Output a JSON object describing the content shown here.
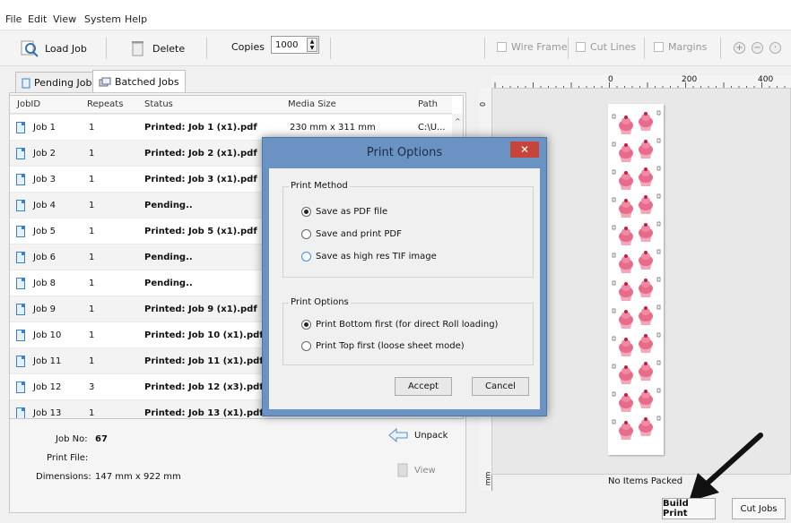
{
  "menu": [
    "File",
    "Edit",
    "View",
    "System",
    "Help"
  ],
  "toolbar": {
    "load_job": "Load Job",
    "delete": "Delete",
    "copies_label": "Copies",
    "copies_value": "1000",
    "wire_frame": "Wire Frame",
    "cut_lines": "Cut Lines",
    "margins": "Margins"
  },
  "tabs": {
    "pending": "Pending Jobs",
    "batched": "Batched Jobs"
  },
  "grid": {
    "headers": [
      "JobID",
      "Repeats",
      "Status",
      "Media Size",
      "Path"
    ],
    "rows": [
      {
        "id": "Job 1",
        "repeats": "1",
        "status": "Printed: Job 1 (x1).pdf",
        "media": "230 mm x 311 mm",
        "path": "C:\\U..."
      },
      {
        "id": "Job 2",
        "repeats": "1",
        "status": "Printed: Job 2 (x1).pdf"
      },
      {
        "id": "Job 3",
        "repeats": "1",
        "status": "Printed: Job 3 (x1).pdf"
      },
      {
        "id": "Job 4",
        "repeats": "1",
        "status": "Pending.."
      },
      {
        "id": "Job 5",
        "repeats": "1",
        "status": "Printed: Job 5 (x1).pdf"
      },
      {
        "id": "Job 6",
        "repeats": "1",
        "status": "Pending.."
      },
      {
        "id": "Job 8",
        "repeats": "1",
        "status": "Pending.."
      },
      {
        "id": "Job 9",
        "repeats": "1",
        "status": "Printed: Job 9 (x1).pdf"
      },
      {
        "id": "Job 10",
        "repeats": "1",
        "status": "Printed: Job 10 (x1).pdf"
      },
      {
        "id": "Job 11",
        "repeats": "1",
        "status": "Printed: Job 11 (x1).pdf"
      },
      {
        "id": "Job 12",
        "repeats": "3",
        "status": "Printed: Job 12 (x3).pdf"
      },
      {
        "id": "Job 13",
        "repeats": "1",
        "status": "Printed: Job 13 (x1).pdf"
      }
    ]
  },
  "info": {
    "job_no_label": "Job No:",
    "job_no_value": "67",
    "print_file_label": "Print File:",
    "dimensions_label": "Dimensions:",
    "dimensions_value": "147 mm x 922 mm",
    "unpack": "Unpack",
    "view": "View"
  },
  "ruler": {
    "ticks": [
      "0",
      "200",
      "400"
    ],
    "left_zero": "0",
    "left_unit": "mm"
  },
  "preview": {
    "status": "No Items Packed"
  },
  "buttons": {
    "build_print": "Build Print",
    "cut_jobs": "Cut Jobs"
  },
  "dialog": {
    "title": "Print Options",
    "close": "✕",
    "method_group": "Print Method",
    "method_options": [
      "Save as PDF file",
      "Save and print PDF",
      "Save as high res TIF image"
    ],
    "method_selected": 0,
    "options_group": "Print Options",
    "order_options": [
      "Print Bottom first (for direct Roll loading)",
      "Print Top first (loose sheet mode)"
    ],
    "order_selected": 0,
    "accept": "Accept",
    "cancel": "Cancel"
  },
  "colors": {
    "dialog_frame": "#6a93c4",
    "close_red": "#c7443b",
    "cupcake_pink": "#e86b8a"
  }
}
